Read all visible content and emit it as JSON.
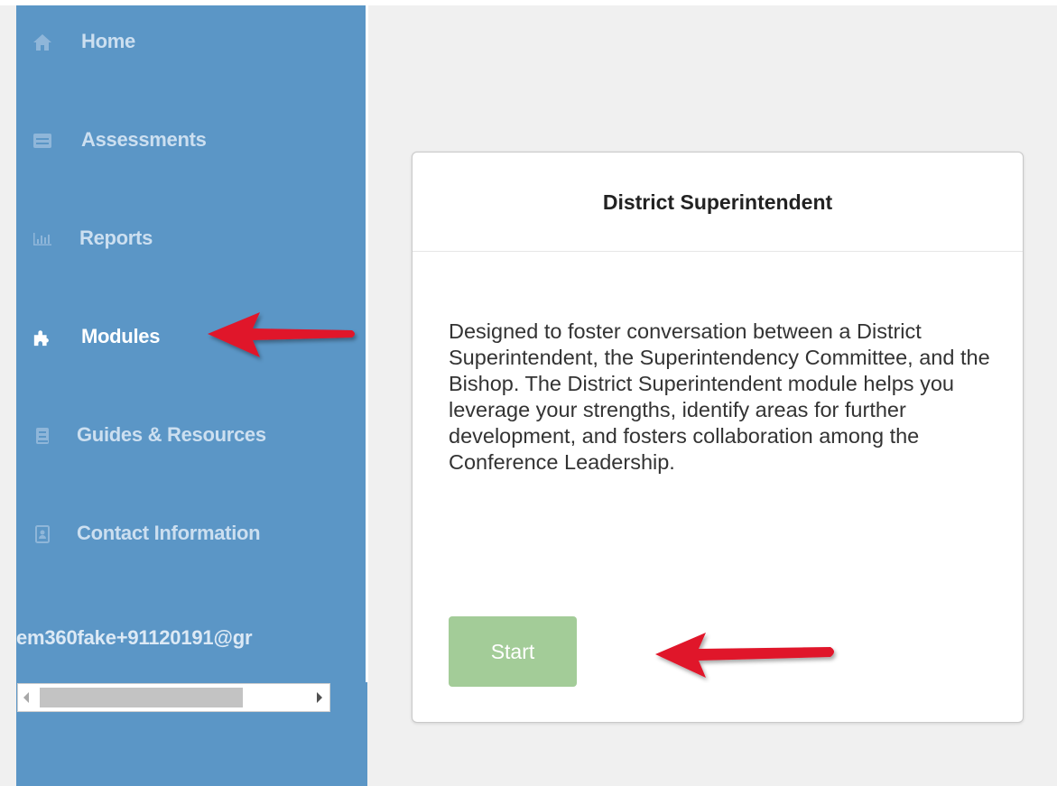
{
  "sidebar": {
    "items": [
      {
        "label": "Home",
        "icon": "home-icon"
      },
      {
        "label": "Assessments",
        "icon": "assessments-icon"
      },
      {
        "label": "Reports",
        "icon": "bar-chart-icon"
      },
      {
        "label": "Modules",
        "icon": "puzzle-icon"
      },
      {
        "label": "Guides & Resources",
        "icon": "book-icon"
      },
      {
        "label": "Contact Information",
        "icon": "contact-card-icon"
      }
    ],
    "active_item": "Modules",
    "email": "em360fake+91120191@gr"
  },
  "card": {
    "title": "District Superintendent",
    "description": "Designed to foster conversation between a District Superintendent, the Superintendency Committee, and the Bishop. The District Superintendent module helps you leverage your strengths, identify areas for further development, and fosters collaboration among the Conference Leadership.",
    "start_label": "Start"
  },
  "colors": {
    "sidebar_bg": "#5b96c6",
    "start_button": "#a3cc98",
    "annotation_arrow": "#e0142b"
  }
}
